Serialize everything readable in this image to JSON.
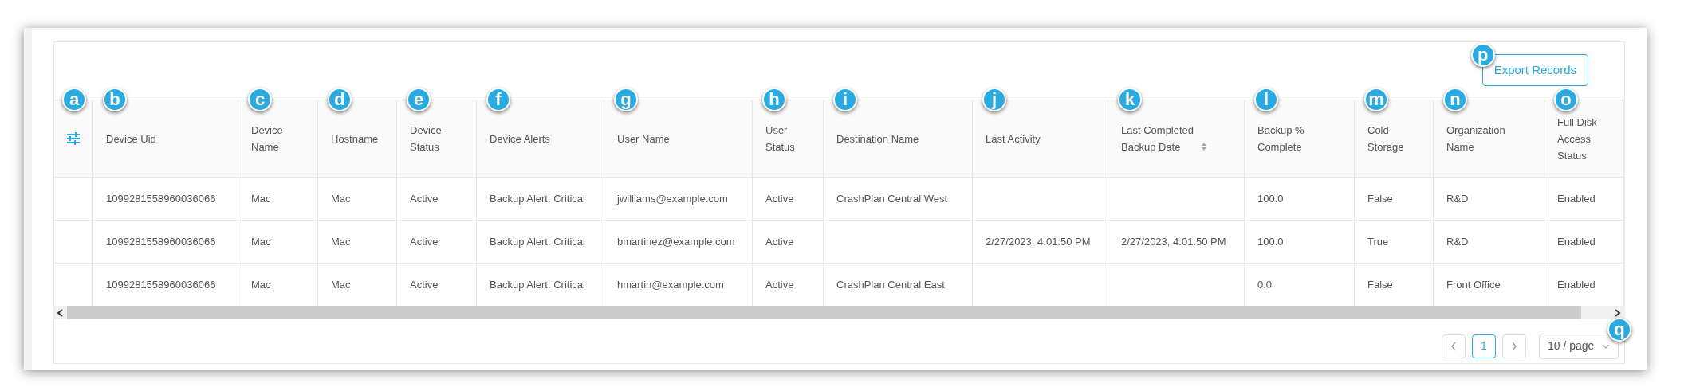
{
  "export_button": {
    "label": "Export Records",
    "callout": "p"
  },
  "settings_callout": "a",
  "columns": [
    {
      "label": "Device Uid",
      "callout": "b",
      "sortable": false
    },
    {
      "label": "Device Name",
      "callout": "c",
      "sortable": false
    },
    {
      "label": "Hostname",
      "callout": "d",
      "sortable": false
    },
    {
      "label": "Device Status",
      "callout": "e",
      "sortable": false
    },
    {
      "label": "Device Alerts",
      "callout": "f",
      "sortable": false
    },
    {
      "label": "User Name",
      "callout": "g",
      "sortable": false
    },
    {
      "label": "User Status",
      "callout": "h",
      "sortable": false
    },
    {
      "label": "Destination Name",
      "callout": "i",
      "sortable": false
    },
    {
      "label": "Last Activity",
      "callout": "j",
      "sortable": false
    },
    {
      "label": "Last Completed Backup Date",
      "callout": "k",
      "sortable": true
    },
    {
      "label": "Backup % Complete",
      "callout": "l",
      "sortable": false
    },
    {
      "label": "Cold Storage",
      "callout": "m",
      "sortable": false
    },
    {
      "label": "Organization Name",
      "callout": "n",
      "sortable": false
    },
    {
      "label": "Full Disk Access Status",
      "callout": "o",
      "sortable": false
    }
  ],
  "rows": [
    [
      "1099281558960036066",
      "Mac",
      "Mac",
      "Active",
      "Backup Alert: Critical",
      "jwilliams@example.com",
      "Active",
      "CrashPlan Central West",
      "",
      "",
      "100.0",
      "False",
      "R&D",
      "Enabled"
    ],
    [
      "1099281558960036066",
      "Mac",
      "Mac",
      "Active",
      "Backup Alert: Critical",
      "bmartinez@example.com",
      "Active",
      "",
      "2/27/2023, 4:01:50 PM",
      "2/27/2023, 4:01:50 PM",
      "100.0",
      "True",
      "R&D",
      "Enabled"
    ],
    [
      "1099281558960036066",
      "Mac",
      "Mac",
      "Active",
      "Backup Alert: Critical",
      "hmartin@example.com",
      "Active",
      "CrashPlan Central East",
      "",
      "",
      "0.0",
      "False",
      "Front Office",
      "Enabled"
    ]
  ],
  "pagination": {
    "pages": [
      {
        "label": "1",
        "selected": true
      }
    ],
    "page_size": "10 / page",
    "callout": "q"
  }
}
